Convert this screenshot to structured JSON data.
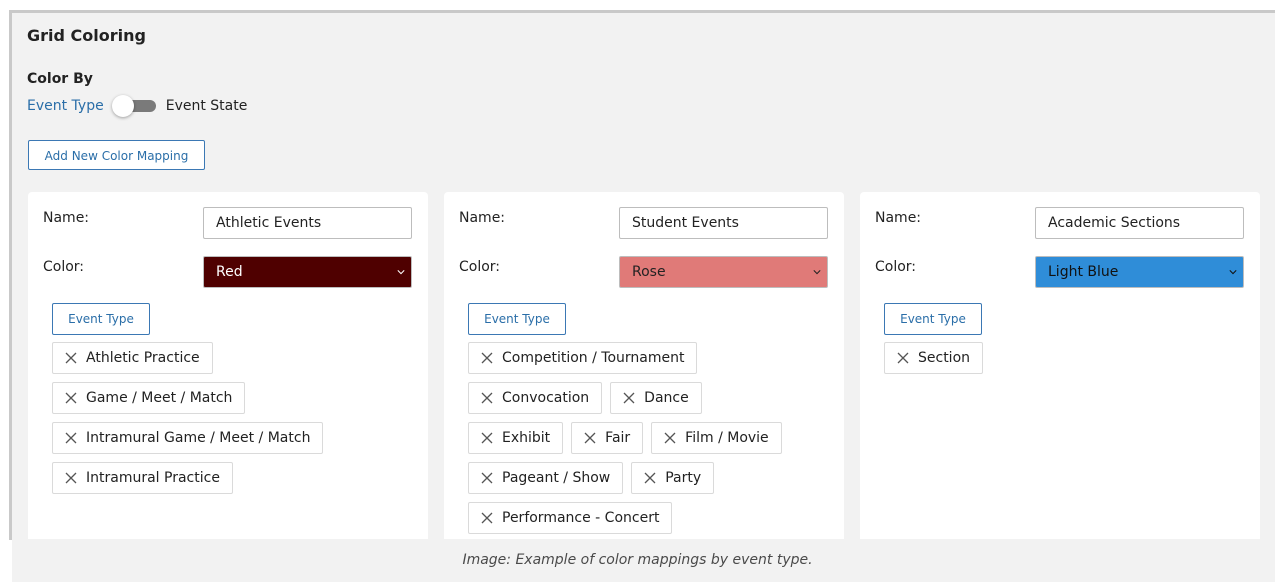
{
  "section_title": "Grid Coloring",
  "color_by": {
    "label": "Color By",
    "left_option": "Event Type",
    "right_option": "Event State",
    "toggle_state": "Event Type"
  },
  "add_button_label": "Add New Color Mapping",
  "cards": [
    {
      "name_label": "Name:",
      "name_value": "Athletic Events",
      "color_label": "Color:",
      "color_value": "Red",
      "color_hex": "#4f0000",
      "color_text_hex": "#ffffff",
      "type_button": "Event Type",
      "chip_rows": [
        [
          "Athletic Practice"
        ],
        [
          "Game / Meet / Match"
        ],
        [
          "Intramural Game / Meet / Match"
        ],
        [
          "Intramural Practice"
        ]
      ]
    },
    {
      "name_label": "Name:",
      "name_value": "Student Events",
      "color_label": "Color:",
      "color_value": "Rose",
      "color_hex": "#e07a78",
      "color_text_hex": "#222222",
      "type_button": "Event Type",
      "chip_rows": [
        [
          "Competition / Tournament"
        ],
        [
          "Convocation",
          "Dance"
        ],
        [
          "Exhibit",
          "Fair",
          "Film / Movie"
        ],
        [
          "Pageant / Show",
          "Party"
        ],
        [
          "Performance - Concert"
        ]
      ]
    },
    {
      "name_label": "Name:",
      "name_value": "Academic Sections",
      "color_label": "Color:",
      "color_value": "Light Blue",
      "color_hex": "#2f8dd8",
      "color_text_hex": "#111111",
      "type_button": "Event Type",
      "chip_rows": [
        [
          "Section"
        ]
      ]
    }
  ],
  "caption": "Image: Example of color mappings by event type.",
  "colors": {
    "panel_bg": "#f2f2f2",
    "link_blue": "#2a6ea8",
    "toggle_track": "#7a7a7a"
  }
}
